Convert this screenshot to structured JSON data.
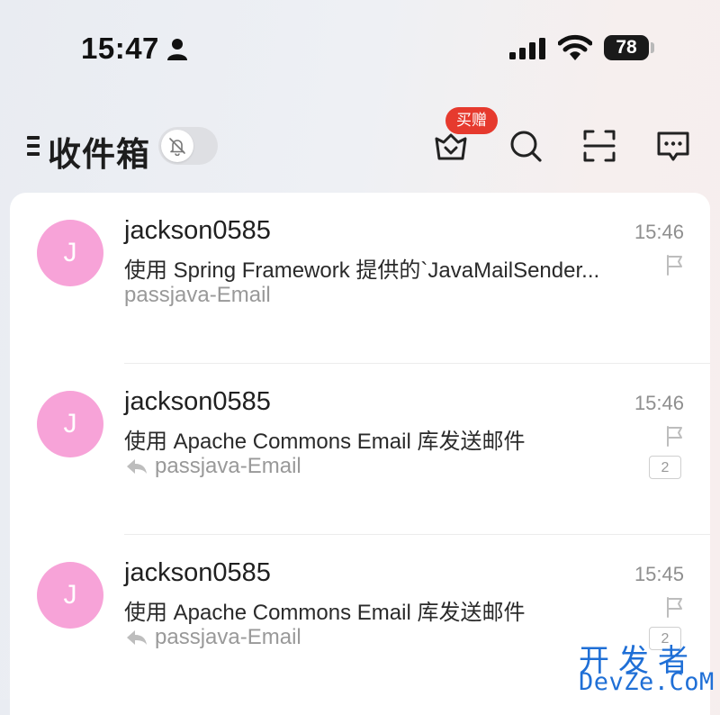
{
  "status_bar": {
    "time": "15:47",
    "battery": "78"
  },
  "header": {
    "title": "收件箱",
    "promo_badge": "买赠"
  },
  "colors": {
    "avatar": "#f7a3d8",
    "badge": "#e63a2e",
    "watermark": "#1f6fd6"
  },
  "icons": [
    "person-icon",
    "signal-icon",
    "wifi-icon",
    "menu-icon",
    "bell-off-icon",
    "shop-icon",
    "search-icon",
    "scan-icon",
    "chat-icon",
    "flag-icon",
    "reply-icon"
  ],
  "emails": [
    {
      "avatar": "J",
      "sender": "jackson0585",
      "time": "15:46",
      "subject": "使用 Spring Framework 提供的`JavaMailSender...",
      "folder": "passjava-Email"
    },
    {
      "avatar": "J",
      "sender": "jackson0585",
      "time": "15:46",
      "subject": "使用 Apache Commons Email 库发送邮件",
      "folder": "passjava-Email",
      "count": "2"
    },
    {
      "avatar": "J",
      "sender": "jackson0585",
      "time": "15:45",
      "subject": "使用 Apache Commons Email 库发送邮件",
      "folder": "passjava-Email",
      "count": "2"
    }
  ],
  "watermark": {
    "cn": "开发者",
    "en": "DevZe.CoM"
  }
}
